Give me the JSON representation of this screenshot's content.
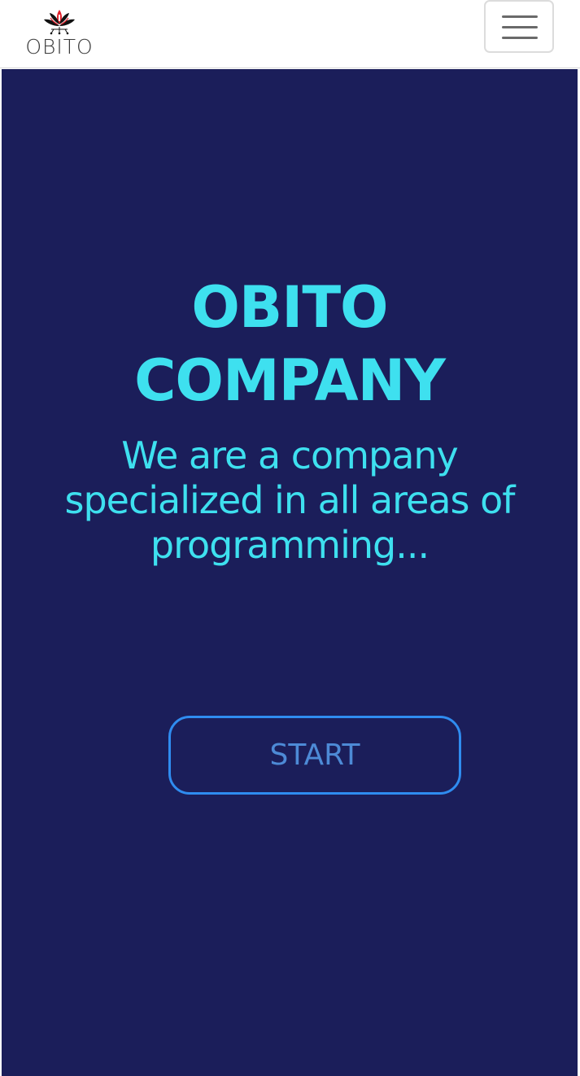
{
  "header": {
    "logo_text": "OBITO",
    "menu_toggle_icon": "hamburger-menu-icon"
  },
  "hero": {
    "title_line1": "OBITO",
    "title_line2": "COMPANY",
    "subtitle": "We are a company specialized in all areas of programming...",
    "cta_label": "START"
  },
  "colors": {
    "hero_background": "#1b1e5a",
    "accent_cyan": "#3ee0ef",
    "button_border": "#2f8cf0",
    "button_text": "#4d8ad6",
    "logo_red": "#e0202a"
  }
}
